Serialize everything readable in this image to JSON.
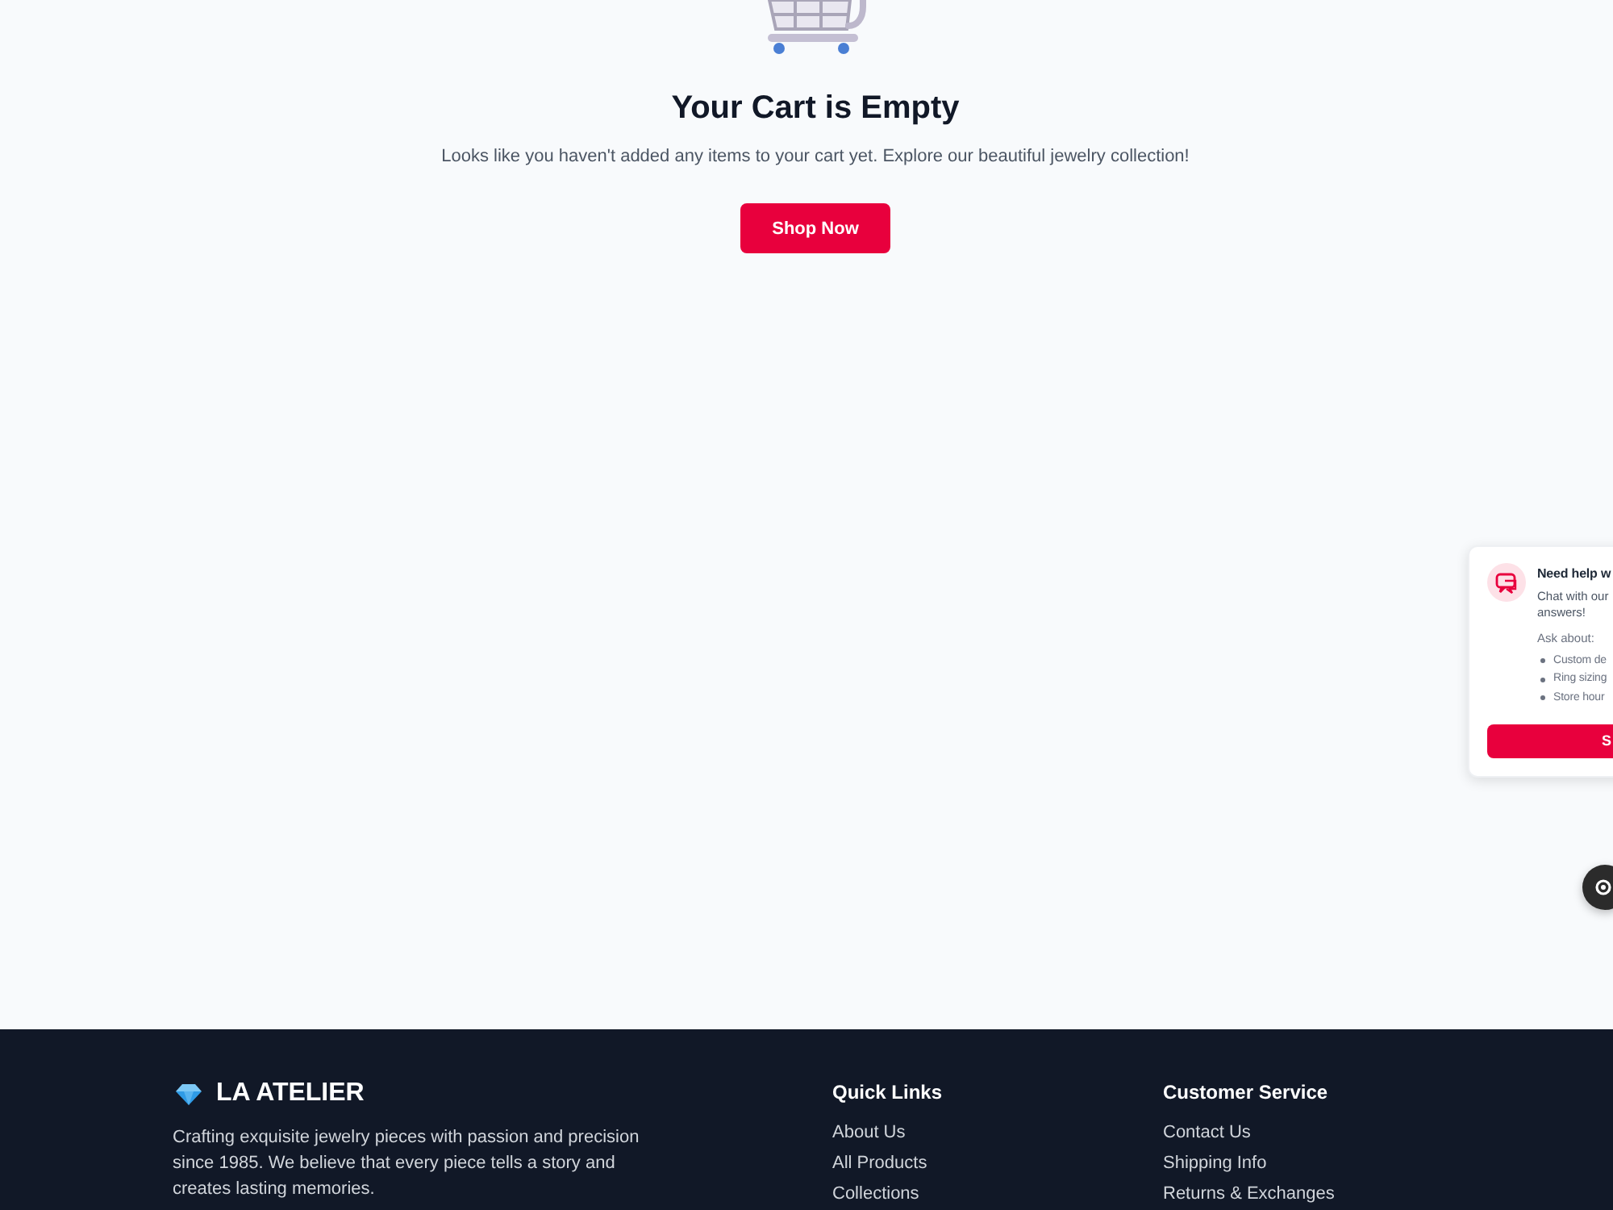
{
  "cart_empty": {
    "title": "Your Cart is Empty",
    "message": "Looks like you haven't added any items to your cart yet. Explore our beautiful jewelry collection!",
    "button": "Shop Now"
  },
  "chat_widget": {
    "title": "Need help w",
    "message_lines": [
      "Chat with our",
      "answers!"
    ],
    "ask_label": "Ask about:",
    "topics": [
      "Custom de",
      "Ring sizing",
      "Store hour"
    ],
    "button": "S"
  },
  "footer": {
    "brand": "LA ATELIER",
    "description": "Crafting exquisite jewelry pieces with passion and precision since 1985. We believe that every piece tells a story and creates lasting memories.",
    "columns": [
      {
        "heading": "Quick Links",
        "links": [
          "About Us",
          "All Products",
          "Collections"
        ]
      },
      {
        "heading": "Customer Service",
        "links": [
          "Contact Us",
          "Shipping Info",
          "Returns & Exchanges"
        ]
      }
    ]
  }
}
